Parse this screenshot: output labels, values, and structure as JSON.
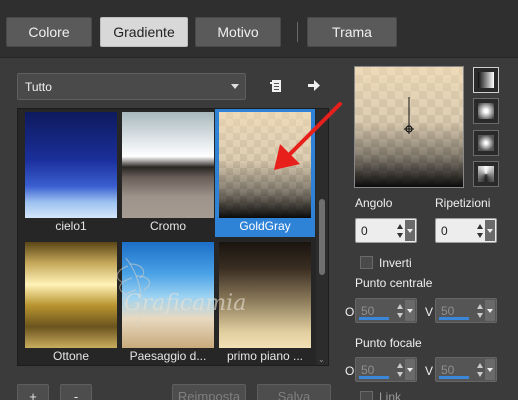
{
  "tabs": [
    {
      "label": "Colore",
      "active": false
    },
    {
      "label": "Gradiente",
      "active": true
    },
    {
      "label": "Motivo",
      "active": false
    },
    {
      "label": "Trama",
      "active": false
    }
  ],
  "library_select": {
    "value": "Tutto"
  },
  "gallery": {
    "items": [
      {
        "label": "cielo1"
      },
      {
        "label": "Cromo"
      },
      {
        "label": "GoldGray",
        "selected": true
      },
      {
        "label": "Ottone"
      },
      {
        "label": "Paesaggio d..."
      },
      {
        "label": "primo piano ..."
      }
    ]
  },
  "properties": {
    "angle": {
      "label": "Angolo",
      "value": "0"
    },
    "repeats": {
      "label": "Ripetizioni",
      "value": "0"
    },
    "invert": {
      "label": "Inverti",
      "checked": false
    },
    "center_point": {
      "label": "Punto centrale",
      "o_label": "O",
      "o_value": "50",
      "v_label": "V",
      "v_value": "50"
    },
    "focal_point": {
      "label": "Punto focale",
      "o_label": "O",
      "o_value": "50",
      "v_label": "V",
      "v_value": "50"
    },
    "link": {
      "label": "Link"
    }
  },
  "footer": {
    "add_label": "+",
    "remove_label": "-",
    "reset_label": "Reimposta",
    "save_label": "Salva"
  },
  "watermark": {
    "text": "Graficamia"
  },
  "colors": {
    "accent": "#2f83d6",
    "annotation_arrow": "#e8201c"
  }
}
